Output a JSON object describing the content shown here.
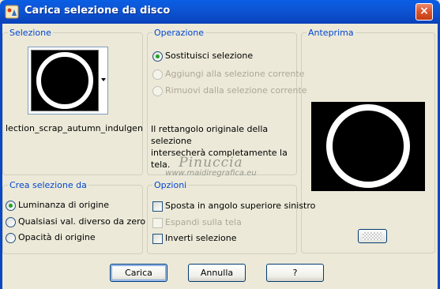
{
  "window": {
    "title": "Carica selezione da disco",
    "close_label": "×"
  },
  "selezione": {
    "legend": "Selezione",
    "selection_name": "lection_scrap_autumn_indulgen"
  },
  "operazione": {
    "legend": "Operazione",
    "options": [
      {
        "label": "Sostituisci selezione",
        "checked": true,
        "enabled": true
      },
      {
        "label": "Aggiungi alla selezione corrente",
        "checked": false,
        "enabled": false
      },
      {
        "label": "Rimuovi dalla selezione corrente",
        "checked": false,
        "enabled": false
      }
    ],
    "info_line1": "Il rettangolo originale della selezione",
    "info_line2": "intersecherà completamente la tela."
  },
  "anteprima": {
    "legend": "Anteprima"
  },
  "crea_selezione": {
    "legend": "Crea selezione da",
    "options": [
      {
        "label": "Luminanza di origine",
        "checked": true
      },
      {
        "label": "Qualsiasi val. diverso da zero",
        "checked": false
      },
      {
        "label": "Opacità di origine",
        "checked": false
      }
    ]
  },
  "opzioni": {
    "legend": "Opzioni",
    "checks": [
      {
        "label": "Sposta in angolo superiore sinistro",
        "checked": false,
        "enabled": true
      },
      {
        "label": "Espandi sulla tela",
        "checked": false,
        "enabled": false
      },
      {
        "label": "Inverti selezione",
        "checked": false,
        "enabled": true
      }
    ]
  },
  "buttons": {
    "load": "Carica",
    "cancel": "Annulla",
    "help": "?"
  },
  "watermark": {
    "line1": "Pinuccia",
    "line2": "www.maidiregrafica.eu"
  },
  "colors": {
    "title_bar": "#0a48c4",
    "dialog_bg": "#ece9d8",
    "legend_text": "#0046d5",
    "disabled_text": "#aca899",
    "radio_dot": "#21a121"
  }
}
